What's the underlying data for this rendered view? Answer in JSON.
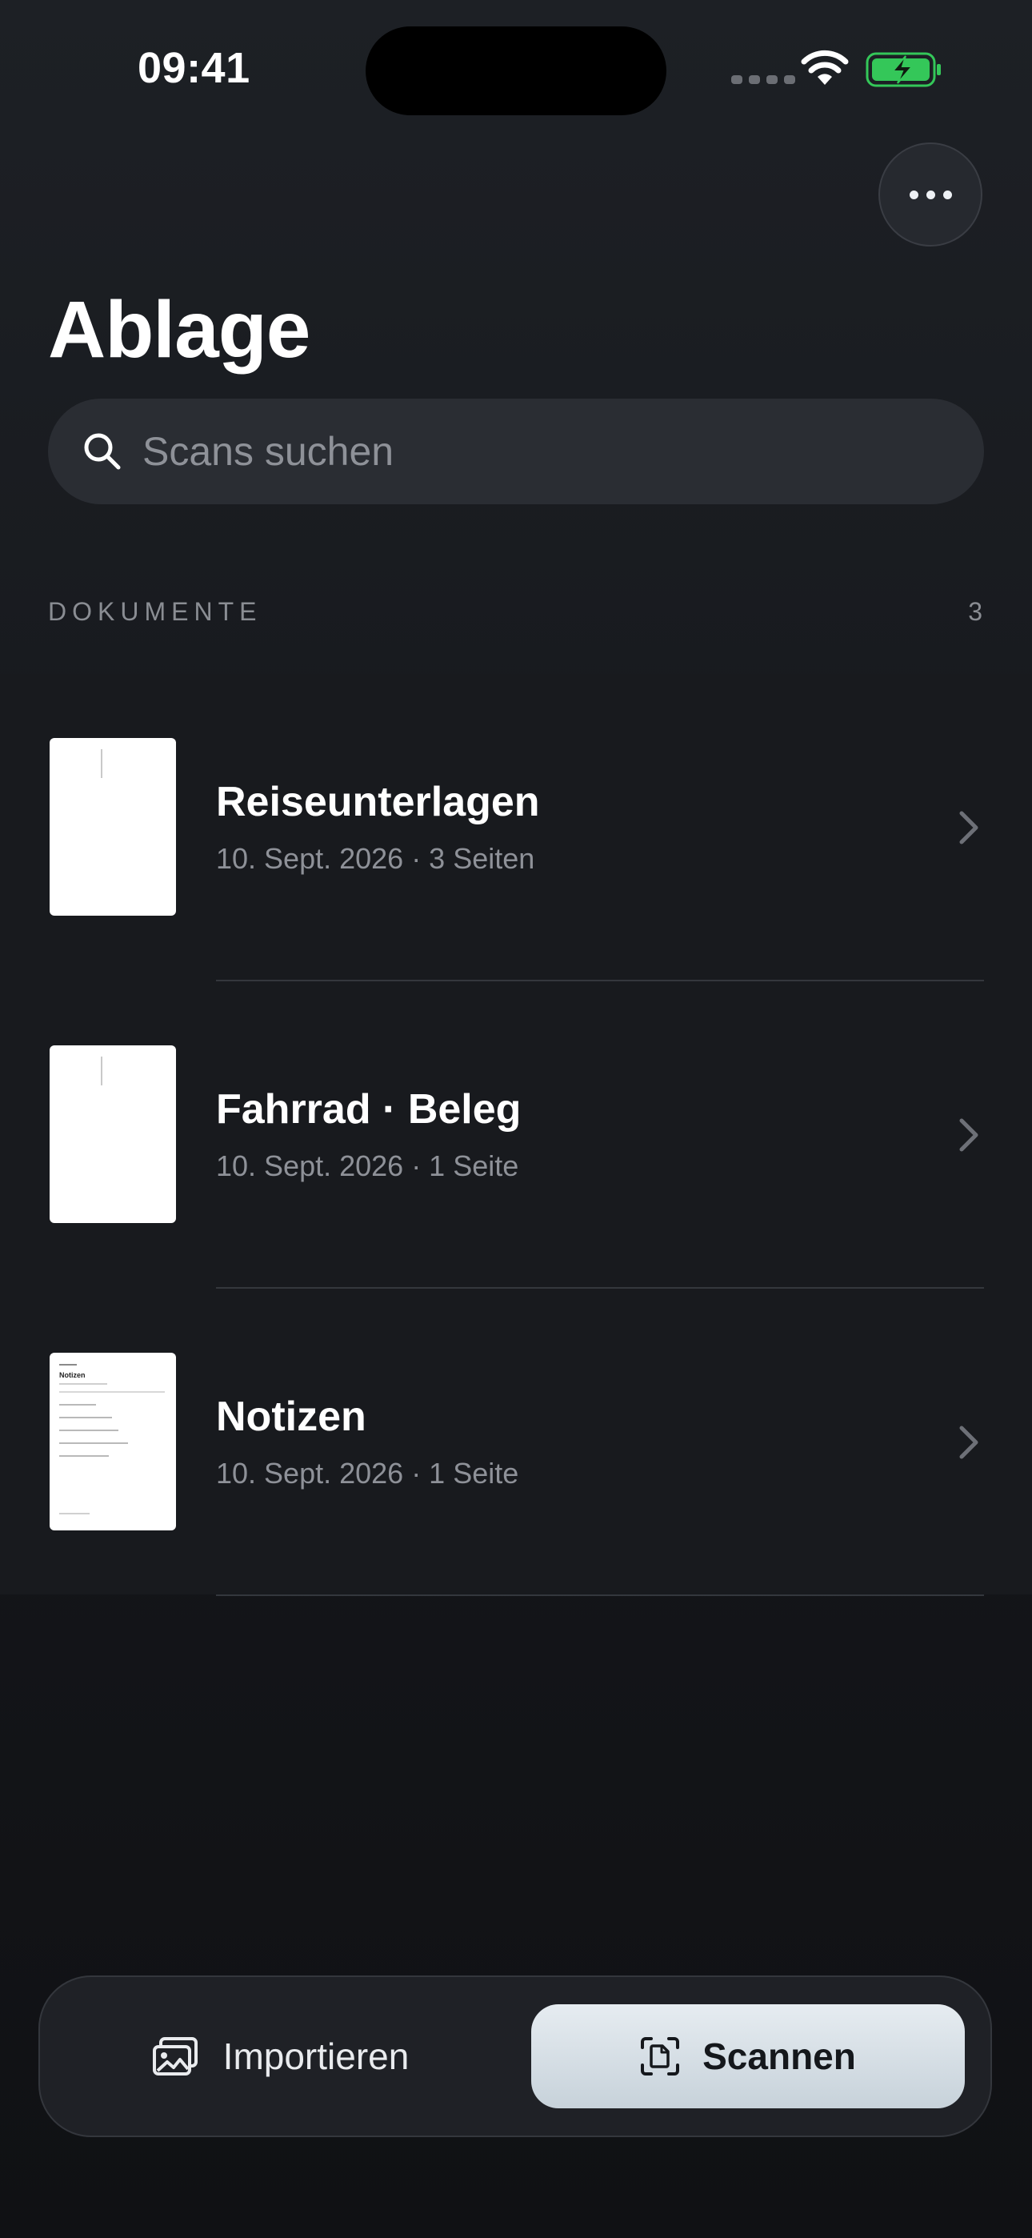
{
  "status": {
    "time": "09:41",
    "icons": [
      "cellular-signal-icon",
      "wifi-icon",
      "battery-charging-icon"
    ],
    "battery_color": "#34c759"
  },
  "header": {
    "title": "Ablage",
    "more_icon": "ellipsis-icon"
  },
  "search": {
    "placeholder": "Scans suchen",
    "icon": "search-icon"
  },
  "section": {
    "label": "DOKUMENTE",
    "count": "3"
  },
  "documents": [
    {
      "title": "Reiseunterlagen",
      "subtitle": "10. Sept. 2026 · 3 Seiten"
    },
    {
      "title": "Fahrrad · Beleg",
      "subtitle": "10. Sept. 2026 · 1 Seite"
    },
    {
      "title": "Notizen",
      "subtitle": "10. Sept. 2026 · 1 Seite",
      "thumb_heading": "Notizen"
    }
  ],
  "bottom_bar": {
    "import_label": "Importieren",
    "import_icon": "photo-stack-icon",
    "scan_label": "Scannen",
    "scan_icon": "document-scanner-icon"
  },
  "colors": {
    "background": "#16181c",
    "surface": "#2a2d33",
    "scan_button": "#d6dfe6",
    "secondary_text": "#8e9198"
  }
}
